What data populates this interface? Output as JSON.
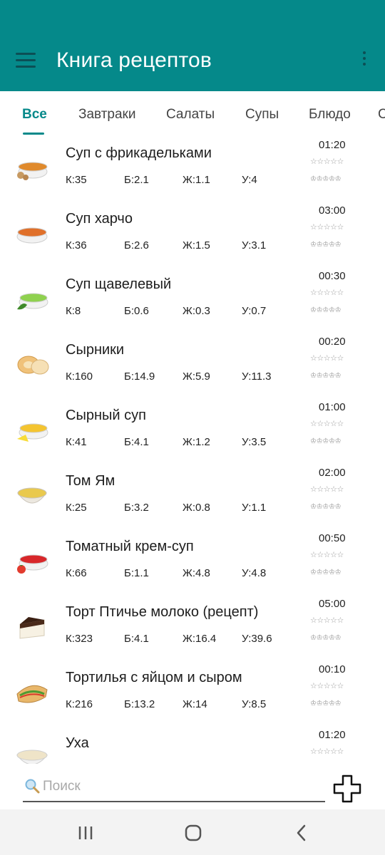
{
  "app": {
    "title": "Книга рецептов"
  },
  "tabs": [
    {
      "label": "Все",
      "active": true
    },
    {
      "label": "Завтраки"
    },
    {
      "label": "Салаты"
    },
    {
      "label": "Супы"
    },
    {
      "label": "Блюдо"
    },
    {
      "label": "С"
    }
  ],
  "recipes": [
    {
      "name": "Суп с фрикадельками",
      "k": "К:35",
      "b": "Б:2.1",
      "zh": "Ж:1.1",
      "u": "У:4",
      "time": "01:20",
      "stars": "☆☆☆☆☆",
      "chef": "♔♔♔♔♔",
      "icon": "meatball-soup-icon"
    },
    {
      "name": "Суп харчо",
      "k": "К:36",
      "b": "Б:2.6",
      "zh": "Ж:1.5",
      "u": "У:3.1",
      "time": "03:00",
      "stars": "☆☆☆☆☆",
      "chef": "♔♔♔♔♔",
      "icon": "kharcho-soup-icon"
    },
    {
      "name": "Суп щавелевый",
      "k": "К:8",
      "b": "Б:0.6",
      "zh": "Ж:0.3",
      "u": "У:0.7",
      "time": "00:30",
      "stars": "☆☆☆☆☆",
      "chef": "♔♔♔♔♔",
      "icon": "sorrel-soup-icon"
    },
    {
      "name": "Сырники",
      "k": "К:160",
      "b": "Б:14.9",
      "zh": "Ж:5.9",
      "u": "У:11.3",
      "time": "00:20",
      "stars": "☆☆☆☆☆",
      "chef": "♔♔♔♔♔",
      "icon": "syrniki-icon"
    },
    {
      "name": "Сырный суп",
      "k": "К:41",
      "b": "Б:4.1",
      "zh": "Ж:1.2",
      "u": "У:3.5",
      "time": "01:00",
      "stars": "☆☆☆☆☆",
      "chef": "♔♔♔♔♔",
      "icon": "cheese-soup-icon"
    },
    {
      "name": "Том Ям",
      "k": "К:25",
      "b": "Б:3.2",
      "zh": "Ж:0.8",
      "u": "У:1.1",
      "time": "02:00",
      "stars": "☆☆☆☆☆",
      "chef": "♔♔♔♔♔",
      "icon": "tom-yum-icon"
    },
    {
      "name": "Томатный крем-суп",
      "k": "К:66",
      "b": "Б:1.1",
      "zh": "Ж:4.8",
      "u": "У:4.8",
      "time": "00:50",
      "stars": "☆☆☆☆☆",
      "chef": "♔♔♔♔♔",
      "icon": "tomato-soup-icon"
    },
    {
      "name": "Торт Птичье молоко (рецепт)",
      "k": "К:323",
      "b": "Б:4.1",
      "zh": "Ж:16.4",
      "u": "У:39.6",
      "time": "05:00",
      "stars": "☆☆☆☆☆",
      "chef": "♔♔♔♔♔",
      "icon": "cake-icon"
    },
    {
      "name": "Тортилья с яйцом и сыром",
      "k": "К:216",
      "b": "Б:13.2",
      "zh": "Ж:14",
      "u": "У:8.5",
      "time": "00:10",
      "stars": "☆☆☆☆☆",
      "chef": "♔♔♔♔♔",
      "icon": "tortilla-icon"
    },
    {
      "name": "Уха",
      "k": "",
      "b": "",
      "zh": "",
      "u": "",
      "time": "01:20",
      "stars": "☆☆☆☆☆",
      "chef": "",
      "icon": "fish-soup-icon"
    }
  ],
  "search": {
    "placeholder": "Поиск",
    "value": ""
  },
  "colors": {
    "accent": "#05898a",
    "menu_icon": "#0c4f55",
    "nav_bg": "#f3f3f3"
  }
}
